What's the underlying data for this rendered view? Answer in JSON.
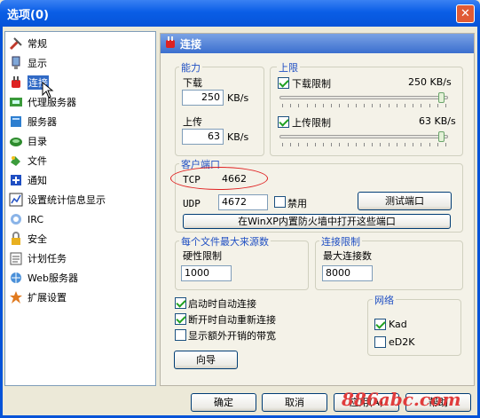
{
  "window": {
    "title": "选项(0)"
  },
  "sidebar": {
    "items": [
      {
        "label": "常规",
        "icon": "tools-icon"
      },
      {
        "label": "显示",
        "icon": "display-icon"
      },
      {
        "label": "连接",
        "icon": "plug-icon",
        "selected": true
      },
      {
        "label": "代理服务器",
        "icon": "proxy-icon"
      },
      {
        "label": "服务器",
        "icon": "server-icon"
      },
      {
        "label": "目录",
        "icon": "folder-icon"
      },
      {
        "label": "文件",
        "icon": "file-icon"
      },
      {
        "label": "通知",
        "icon": "notify-icon"
      },
      {
        "label": "设置统计信息显示",
        "icon": "chart-icon"
      },
      {
        "label": "IRC",
        "icon": "irc-icon"
      },
      {
        "label": "安全",
        "icon": "lock-icon"
      },
      {
        "label": "计划任务",
        "icon": "schedule-icon"
      },
      {
        "label": "Web服务器",
        "icon": "web-icon"
      },
      {
        "label": "扩展设置",
        "icon": "extension-icon"
      }
    ]
  },
  "panel": {
    "title": "连接"
  },
  "capacity": {
    "title": "能力",
    "download_label": "下载",
    "download_value": "250",
    "upload_label": "上传",
    "upload_value": "63",
    "unit": "KB/s"
  },
  "limits": {
    "title": "上限",
    "download_label": "下载限制",
    "download_value": "250 KB/s",
    "download_checked": true,
    "download_level": 0.98,
    "upload_label": "上传限制",
    "upload_value": "63 KB/s",
    "upload_checked": true,
    "upload_level": 0.98
  },
  "client_port": {
    "title": "客户端口",
    "tcp_label": "TCP",
    "tcp_value": "4662",
    "udp_label": "UDP",
    "udp_value": "4672",
    "disable_label": "禁用",
    "test_button": "测试端口",
    "firewall_button": "在WinXP内置防火墙中打开这些端口"
  },
  "max_sources": {
    "title": "每个文件最大来源数",
    "hard_limit_label": "硬性限制",
    "hard_limit_value": "1000"
  },
  "conn_limit": {
    "title": "连接限制",
    "max_conn_label": "最大连接数",
    "max_conn_value": "8000"
  },
  "options": [
    {
      "label": "启动时自动连接",
      "checked": true
    },
    {
      "label": "断开时自动重新连接",
      "checked": true
    },
    {
      "label": "显示额外开销的带宽",
      "checked": false
    }
  ],
  "network": {
    "title": "网络",
    "kad_label": "Kad",
    "kad_checked": true,
    "ed2k_label": "eD2K",
    "ed2k_checked": false
  },
  "wizard_button": "向导",
  "footer": {
    "ok": "确定",
    "cancel": "取消",
    "apply": "应用(A)",
    "help": "帮助"
  },
  "watermark": "886abc.com",
  "colors": {
    "titlebar": "#0A5EE6",
    "selection": "#316AC5",
    "group_title": "#1F4FC3",
    "annotation": "#E02020"
  }
}
